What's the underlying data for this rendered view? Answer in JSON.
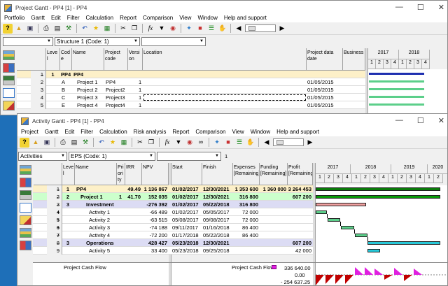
{
  "colors": {
    "accent": "#1e6fb8",
    "gantt_green": "#0a8a0a",
    "gantt_light": "#5ccf8a",
    "gantt_blue": "#1e2fb0",
    "gantt_cyan": "#27c8d8",
    "gantt_pink": "#f0a0a0",
    "sel_row": "#fdf0c8",
    "row_green": "#ccffcc",
    "row_lilac": "#dcdcf4"
  },
  "back": {
    "title": "Project Gantt - PP4 [1] - PP4",
    "menu": [
      "Portfolio",
      "Gantt",
      "Edit",
      "Filter",
      "Calculation",
      "Report",
      "Comparison",
      "View",
      "Window",
      "Help and support"
    ],
    "combo1": "",
    "combo2": "Structure 1 (Code: 1)",
    "combo3": "",
    "headers": {
      "level": "Leve l",
      "code": "Cod e",
      "name": "Name",
      "pcode": "Project code",
      "version": "Versi on",
      "location": "Location",
      "pdate": "Project data date",
      "business": "Business"
    },
    "years": [
      "2017",
      "2018"
    ],
    "quarters": [
      "1",
      "2",
      "3",
      "4",
      "1",
      "2",
      "3",
      "4"
    ],
    "rows": [
      {
        "n": "1",
        "toggle": "–",
        "level": "1",
        "code": "PP4",
        "name": "PP4",
        "pcode": "",
        "version": "",
        "pdate": ""
      },
      {
        "n": "2",
        "toggle": "",
        "level": "",
        "code": "A",
        "name": "Project 1",
        "pcode": "PP4",
        "version": "1",
        "pdate": "01/05/2015"
      },
      {
        "n": "3",
        "toggle": "",
        "level": "",
        "code": "B",
        "name": "Project 2",
        "pcode": "Project2",
        "version": "1",
        "pdate": "01/05/2015"
      },
      {
        "n": "4",
        "toggle": "",
        "level": "",
        "code": "C",
        "name": "Project 3",
        "pcode": "Project3",
        "version": "1",
        "pdate": "01/05/2015"
      },
      {
        "n": "5",
        "toggle": "",
        "level": "",
        "code": "E",
        "name": "Project 4",
        "pcode": "Project4",
        "version": "1",
        "pdate": "01/05/2015"
      }
    ]
  },
  "front": {
    "title": "Activity Gantt - PP4 [1] - PP4",
    "menu": [
      "Project",
      "Gantt",
      "Edit",
      "Filter",
      "Calculation",
      "Risk analysis",
      "Report",
      "Comparison",
      "View",
      "Window",
      "Help and support"
    ],
    "combo1": "Activities",
    "combo2": "EPS (Code: 1)",
    "combo3": "",
    "counter": "1",
    "headers": {
      "level": "Leve l",
      "name": "Name",
      "priority": "Pri ori ty",
      "irr": "IRR",
      "npv": "NPV",
      "start": "Start",
      "finish": "Finish",
      "expenses": "Expenses [Remaining]",
      "funding": "Funding [Remaining]",
      "profit": "Profit [Remaining]"
    },
    "years": [
      "2017",
      "2018",
      "2019",
      "2020"
    ],
    "quarters": [
      "1",
      "2",
      "3",
      "4",
      "1",
      "2",
      "3",
      "4",
      "1",
      "2",
      "3",
      "4",
      "1",
      "2"
    ],
    "rows": [
      {
        "n": "1",
        "toggle": "–",
        "level": "1",
        "name": "PP4",
        "priority": "",
        "irr": "49.49",
        "npv": "1 136 867",
        "start": "01/02/2017",
        "finish": "12/30/2021",
        "expenses": "1 353 600",
        "funding": "1 360 000",
        "profit": "3 264 453",
        "style": "sel"
      },
      {
        "n": "2",
        "toggle": "–",
        "level": "2",
        "name": "Project 1",
        "priority": "1",
        "irr": "41.70",
        "npv": "152 035",
        "start": "01/02/2017",
        "finish": "12/30/2021",
        "expenses": "316 800",
        "funding": "",
        "profit": "607 200",
        "style": "green"
      },
      {
        "n": "3",
        "toggle": "–",
        "level": "3",
        "name": "Investment",
        "priority": "",
        "irr": "",
        "npv": "-276 392",
        "start": "01/02/2017",
        "finish": "05/22/2018",
        "expenses": "316 800",
        "funding": "",
        "profit": "",
        "style": "lilac"
      },
      {
        "n": "4",
        "toggle": "+",
        "level": "",
        "name": "Activity 1",
        "priority": "",
        "irr": "",
        "npv": "-66 489",
        "start": "01/02/2017",
        "finish": "05/05/2017",
        "expenses": "72 000",
        "funding": "",
        "profit": "",
        "style": ""
      },
      {
        "n": "5",
        "toggle": "+",
        "level": "",
        "name": "Activity 2",
        "priority": "",
        "irr": "",
        "npv": "-63 515",
        "start": "05/08/2017",
        "finish": "09/08/2017",
        "expenses": "72 000",
        "funding": "",
        "profit": "",
        "style": ""
      },
      {
        "n": "6",
        "toggle": "+",
        "level": "",
        "name": "Activity 3",
        "priority": "",
        "irr": "",
        "npv": "-74 188",
        "start": "09/11/2017",
        "finish": "01/16/2018",
        "expenses": "86 400",
        "funding": "",
        "profit": "",
        "style": ""
      },
      {
        "n": "7",
        "toggle": "+",
        "level": "",
        "name": "Activity 4",
        "priority": "",
        "irr": "",
        "npv": "-72 200",
        "start": "01/17/2018",
        "finish": "05/22/2018",
        "expenses": "86 400",
        "funding": "",
        "profit": "",
        "style": ""
      },
      {
        "n": "8",
        "toggle": "–",
        "level": "3",
        "name": "Operations",
        "priority": "",
        "irr": "",
        "npv": "428 427",
        "start": "05/23/2018",
        "finish": "12/30/2021",
        "expenses": "",
        "funding": "",
        "profit": "607 200",
        "style": "lilac"
      },
      {
        "n": "9",
        "toggle": "",
        "level": "",
        "name": "Activity 5",
        "priority": "",
        "irr": "",
        "npv": "33 400",
        "start": "05/23/2018",
        "finish": "09/25/2018",
        "expenses": "",
        "funding": "",
        "profit": "42 000",
        "style": ""
      }
    ],
    "cashflow": {
      "left_label": "Project Cash Flow",
      "legend_label": "Project Cash Flow",
      "val_top": "336 640.00",
      "val_mid": "0.00",
      "val_bot": "- 254 637.25"
    }
  }
}
